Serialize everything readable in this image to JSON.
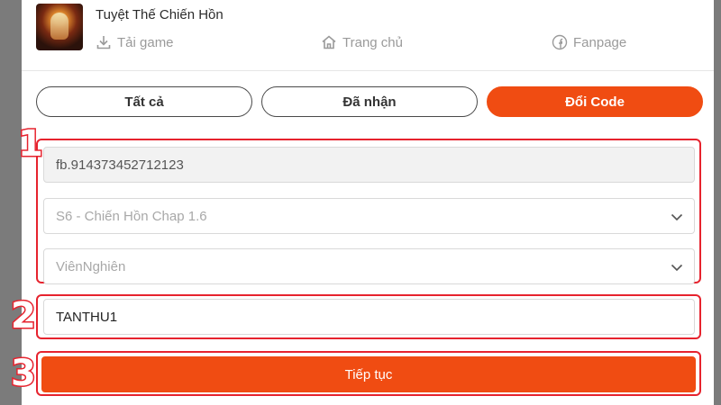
{
  "header": {
    "game_title": "Tuyệt Thế Chiến Hồn",
    "nav": {
      "download": {
        "label": "Tải game",
        "icon": "download-icon"
      },
      "home": {
        "label": "Trang chủ",
        "icon": "home-icon"
      },
      "fanpage": {
        "label": "Fanpage",
        "icon": "facebook-icon"
      }
    }
  },
  "tabs": [
    {
      "label": "Tất cả",
      "active": false
    },
    {
      "label": "Đã nhận",
      "active": false
    },
    {
      "label": "Đổi Code",
      "active": true
    }
  ],
  "form": {
    "account_id": "fb.914373452712123",
    "server_select": "S6 - Chiến Hồn Chap 1.6",
    "character_select": "ViênNghiên",
    "code_value": "TANTHU1",
    "submit_label": "Tiếp tục"
  },
  "annotations": {
    "step1": "1",
    "step2": "2",
    "step3": "3"
  },
  "colors": {
    "accent": "#f04c12",
    "annotation": "#e6232e",
    "backdrop": "#7b7b7b"
  }
}
